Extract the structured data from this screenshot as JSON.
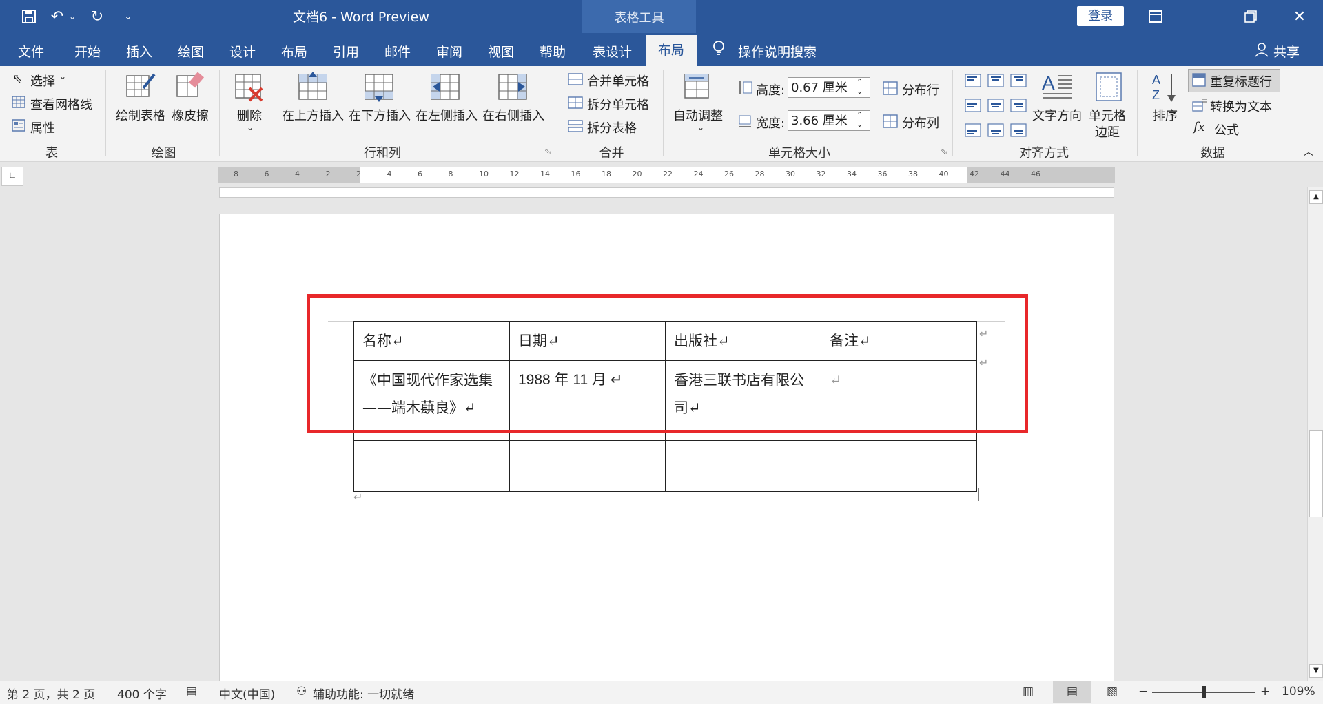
{
  "title_bar": {
    "doc_title": "文档6  -  Word Preview",
    "tool_tab": "表格工具",
    "login": "登录",
    "qat_dropdown": "⌄"
  },
  "menu": {
    "items": [
      "文件",
      "开始",
      "插入",
      "绘图",
      "设计",
      "布局",
      "引用",
      "邮件",
      "审阅",
      "视图",
      "帮助",
      "表设计"
    ],
    "active": "布局",
    "search": "操作说明搜索",
    "share": "共享"
  },
  "ribbon": {
    "table_group": {
      "select": "选择",
      "view_gridlines": "查看网格线",
      "properties": "属性",
      "label": "表"
    },
    "draw_group": {
      "draw_table": "绘制表格",
      "eraser": "橡皮擦",
      "label": "绘图"
    },
    "rows_cols": {
      "delete": "删除",
      "insert_above": "在上方插入",
      "insert_below": "在下方插入",
      "insert_left": "在左侧插入",
      "insert_right": "在右侧插入",
      "label": "行和列"
    },
    "merge": {
      "merge_cells": "合并单元格",
      "split_cells": "拆分单元格",
      "split_table": "拆分表格",
      "label": "合并"
    },
    "cell_size": {
      "autofit": "自动调整",
      "height_label": "高度:",
      "height_value": "0.67 厘米",
      "width_label": "宽度:",
      "width_value": "3.66 厘米",
      "distribute_rows": "分布行",
      "distribute_cols": "分布列",
      "label": "单元格大小"
    },
    "alignment": {
      "text_direction": "文字方向",
      "cell_margins_1": "单元格",
      "cell_margins_2": "边距",
      "label": "对齐方式"
    },
    "data": {
      "sort": "排序",
      "repeat_header": "重复标题行",
      "convert_to_text": "转换为文本",
      "formula": "公式",
      "label": "数据"
    }
  },
  "ruler": {
    "ticks": [
      "8",
      "6",
      "4",
      "2",
      "2",
      "4",
      "6",
      "8",
      "10",
      "12",
      "14",
      "16",
      "18",
      "20",
      "22",
      "24",
      "26",
      "28",
      "30",
      "32",
      "34",
      "36",
      "38",
      "40",
      "42",
      "44",
      "46"
    ]
  },
  "table": {
    "headers": [
      "名称↵",
      "日期↵",
      "出版社↵",
      "备注↵"
    ],
    "row1": [
      "《中国现代作家选集——端木蕻良》↵",
      "1988 年 11 月 ↵",
      "香港三联书店有限公司↵",
      "↵"
    ],
    "row2": [
      "",
      "",
      "",
      ""
    ]
  },
  "marks": {
    "paragraph": "↵"
  },
  "status": {
    "page": "第 2 页，共 2 页",
    "words": "400 个字",
    "language": "中文(中国)",
    "accessibility": "辅助功能: 一切就绪",
    "zoom": "109%"
  }
}
